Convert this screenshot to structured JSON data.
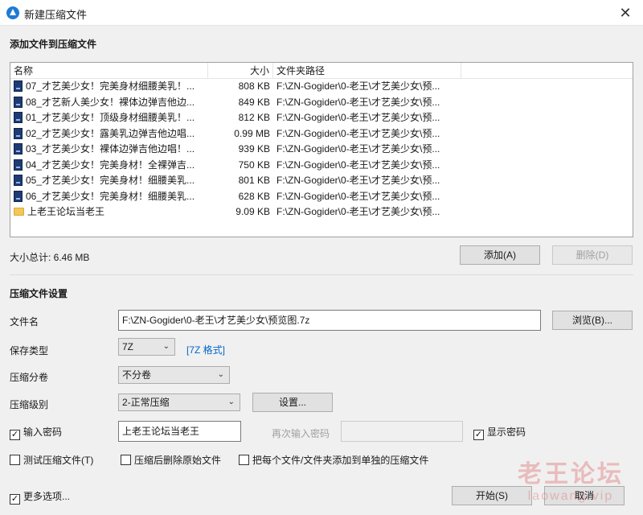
{
  "window": {
    "title": "新建压缩文件",
    "close_glyph": "✕"
  },
  "add_section": {
    "title": "添加文件到压缩文件"
  },
  "file_list": {
    "columns": {
      "name": "名称",
      "size": "大小",
      "path": "文件夹路径"
    },
    "rows": [
      {
        "icon": "image-file-icon",
        "name": "07_才艺美少女！完美身材细腰美乳！...",
        "size": "808 KB",
        "path": "F:\\ZN-Gogider\\0-老王\\才艺美少女\\预..."
      },
      {
        "icon": "image-file-icon",
        "name": "08_才艺新人美少女！裸体边弹吉他边...",
        "size": "849 KB",
        "path": "F:\\ZN-Gogider\\0-老王\\才艺美少女\\预..."
      },
      {
        "icon": "image-file-icon",
        "name": "01_才艺美少女！顶级身材细腰美乳！...",
        "size": "812 KB",
        "path": "F:\\ZN-Gogider\\0-老王\\才艺美少女\\预..."
      },
      {
        "icon": "image-file-icon",
        "name": "02_才艺美少女！露美乳边弹吉他边唱...",
        "size": "0.99 MB",
        "path": "F:\\ZN-Gogider\\0-老王\\才艺美少女\\预..."
      },
      {
        "icon": "image-file-icon",
        "name": "03_才艺美少女！裸体边弹吉他边唱！...",
        "size": "939 KB",
        "path": "F:\\ZN-Gogider\\0-老王\\才艺美少女\\预..."
      },
      {
        "icon": "image-file-icon",
        "name": "04_才艺美少女！完美身材！全裸弹吉...",
        "size": "750 KB",
        "path": "F:\\ZN-Gogider\\0-老王\\才艺美少女\\预..."
      },
      {
        "icon": "image-file-icon",
        "name": "05_才艺美少女！完美身材！细腰美乳...",
        "size": "801 KB",
        "path": "F:\\ZN-Gogider\\0-老王\\才艺美少女\\预..."
      },
      {
        "icon": "image-file-icon",
        "name": "06_才艺美少女！完美身材！细腰美乳...",
        "size": "628 KB",
        "path": "F:\\ZN-Gogider\\0-老王\\才艺美少女\\预..."
      },
      {
        "icon": "folder-icon",
        "name": "上老王论坛当老王",
        "size": "9.09 KB",
        "path": "F:\\ZN-Gogider\\0-老王\\才艺美少女\\预..."
      }
    ]
  },
  "summary": {
    "total_size": "大小总计: 6.46 MB"
  },
  "buttons": {
    "add": "添加(A)",
    "delete": "删除(D)",
    "browse": "浏览(B)...",
    "settings": "设置...",
    "start": "开始(S)",
    "cancel": "取消"
  },
  "settings_section": {
    "title": "压缩文件设置",
    "filename_label": "文件名",
    "filename_value": "F:\\ZN-Gogider\\0-老王\\才艺美少女\\预览图.7z",
    "save_type_label": "保存类型",
    "save_type_value": "7Z",
    "format_link": "[7Z 格式]",
    "split_label": "压缩分卷",
    "split_value": "不分卷",
    "level_label": "压缩级别",
    "level_value": "2-正常压缩",
    "password_check": "输入密码",
    "password_value": "上老王论坛当老王",
    "reenter_label": "再次输入密码",
    "reenter_value": "",
    "show_password": "显示密码",
    "test_archive": "测试压缩文件(T)",
    "delete_after": "压缩后删除原始文件",
    "separate_archives": "把每个文件/文件夹添加到单独的压缩文件",
    "more_options": "更多选项..."
  },
  "states": {
    "password_checked": true,
    "show_password_checked": true,
    "test_checked": false,
    "delete_checked": false,
    "separate_checked": false,
    "more_options_checked": true
  },
  "watermark": {
    "title": "老王论坛",
    "sub": "laowang.vip"
  },
  "colors": {
    "accent": "#1f7ad6",
    "link": "#0066cc",
    "dialog_bg": "#f0f0f0"
  }
}
